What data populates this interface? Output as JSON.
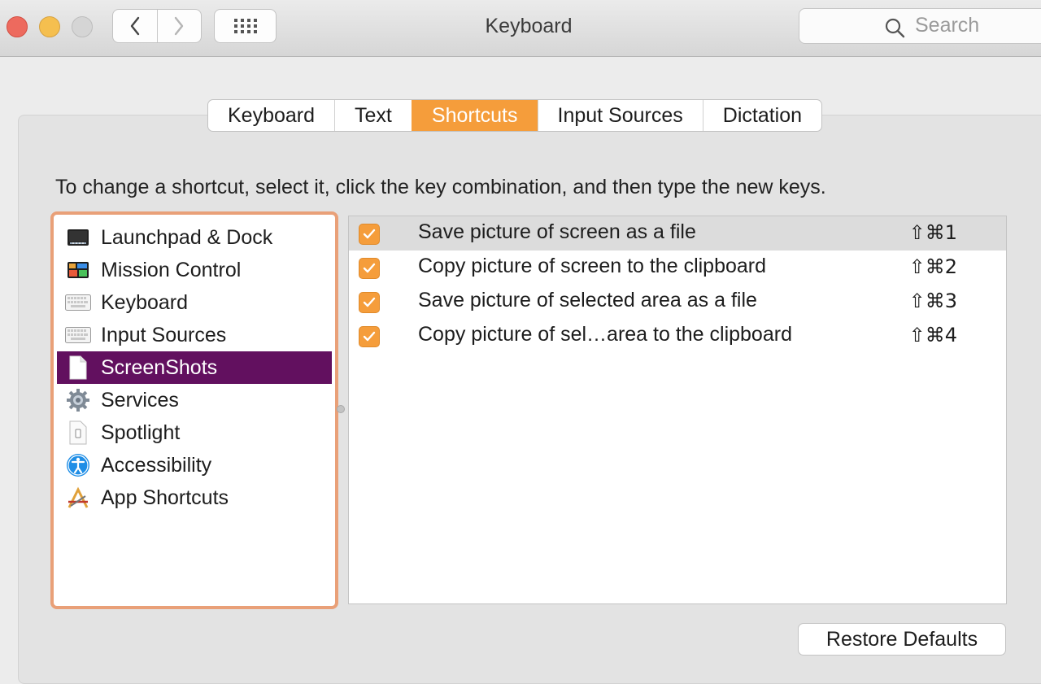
{
  "window": {
    "title": "Keyboard"
  },
  "search": {
    "placeholder": "Search"
  },
  "tabs": [
    {
      "label": "Keyboard"
    },
    {
      "label": "Text"
    },
    {
      "label": "Shortcuts"
    },
    {
      "label": "Input Sources"
    },
    {
      "label": "Dictation"
    }
  ],
  "active_tab": "Shortcuts",
  "instruction": "To change a shortcut, select it, click the key combination, and then type the new keys.",
  "categories": [
    {
      "label": "Launchpad & Dock",
      "icon": "launchpad-dock-icon"
    },
    {
      "label": "Mission Control",
      "icon": "mission-control-icon"
    },
    {
      "label": "Keyboard",
      "icon": "keyboard-icon"
    },
    {
      "label": "Input Sources",
      "icon": "input-sources-icon"
    },
    {
      "label": "ScreenShots",
      "icon": "document-icon"
    },
    {
      "label": "Services",
      "icon": "gear-icon"
    },
    {
      "label": "Spotlight",
      "icon": "spotlight-icon"
    },
    {
      "label": "Accessibility",
      "icon": "accessibility-icon"
    },
    {
      "label": "App Shortcuts",
      "icon": "app-shortcuts-icon"
    }
  ],
  "selected_category": "ScreenShots",
  "shortcuts": [
    {
      "enabled": true,
      "label": "Save picture of screen as a file",
      "keys": "⇧⌘1"
    },
    {
      "enabled": true,
      "label": "Copy picture of screen to the clipboard",
      "keys": "⇧⌘2"
    },
    {
      "enabled": true,
      "label": "Save picture of selected area as a file",
      "keys": "⇧⌘3"
    },
    {
      "enabled": true,
      "label": "Copy picture of sel…area to the clipboard",
      "keys": "⇧⌘4"
    }
  ],
  "restore_button": "Restore Defaults",
  "colors": {
    "accent": "#f59d3b",
    "selection": "#62105f",
    "list_border": "#e9a078"
  }
}
